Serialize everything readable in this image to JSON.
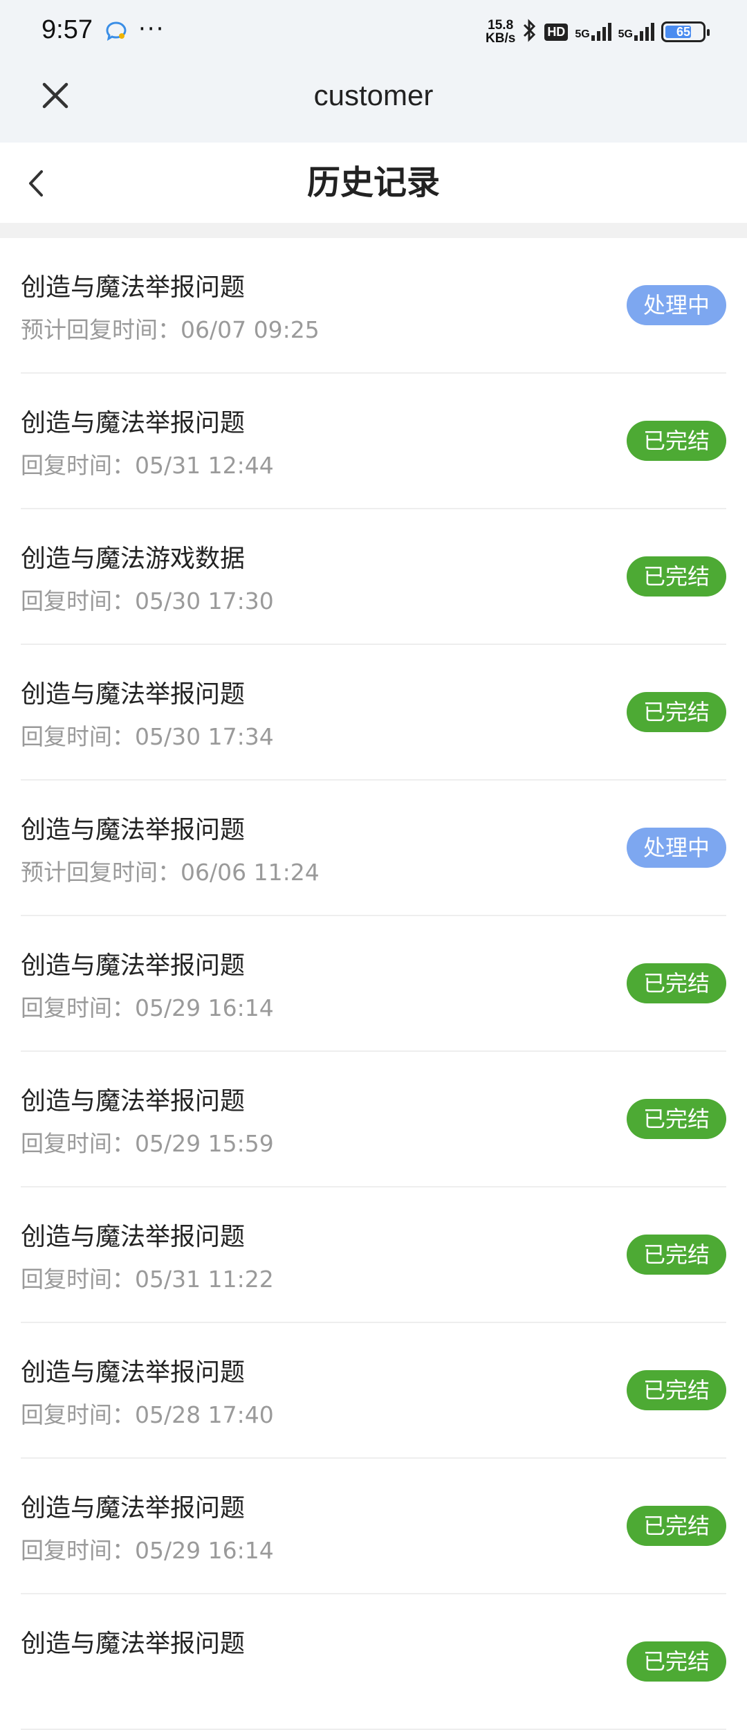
{
  "status_bar": {
    "time": "9:57",
    "more": "···",
    "net_speed_value": "15.8",
    "net_speed_unit": "KB/s",
    "hd": "HD",
    "sim1": "5G",
    "sim2": "5G",
    "battery": "65",
    "icons": [
      "message-icon",
      "bluetooth-icon",
      "signal-icon",
      "battery-icon"
    ]
  },
  "app_bar": {
    "title": "customer",
    "close_icon": "close-icon"
  },
  "nav": {
    "title": "历史记录",
    "back_icon": "chevron-left-icon"
  },
  "colors": {
    "processing": "#7da7f0",
    "done": "#4daa34",
    "subtext": "#9a9a9a"
  },
  "records": [
    {
      "title": "创造与魔法举报问题",
      "time": "预计回复时间：06/07 09:25",
      "status": "处理中",
      "state": "processing"
    },
    {
      "title": "创造与魔法举报问题",
      "time": "回复时间：05/31 12:44",
      "status": "已完结",
      "state": "done"
    },
    {
      "title": "创造与魔法游戏数据",
      "time": "回复时间：05/30 17:30",
      "status": "已完结",
      "state": "done"
    },
    {
      "title": "创造与魔法举报问题",
      "time": "回复时间：05/30 17:34",
      "status": "已完结",
      "state": "done"
    },
    {
      "title": "创造与魔法举报问题",
      "time": "预计回复时间：06/06 11:24",
      "status": "处理中",
      "state": "processing"
    },
    {
      "title": "创造与魔法举报问题",
      "time": "回复时间：05/29 16:14",
      "status": "已完结",
      "state": "done"
    },
    {
      "title": "创造与魔法举报问题",
      "time": "回复时间：05/29 15:59",
      "status": "已完结",
      "state": "done"
    },
    {
      "title": "创造与魔法举报问题",
      "time": "回复时间：05/31 11:22",
      "status": "已完结",
      "state": "done"
    },
    {
      "title": "创造与魔法举报问题",
      "time": "回复时间：05/28 17:40",
      "status": "已完结",
      "state": "done"
    },
    {
      "title": "创造与魔法举报问题",
      "time": "回复时间：05/29 16:14",
      "status": "已完结",
      "state": "done"
    },
    {
      "title": "创造与魔法举报问题",
      "time": "",
      "status": "已完结",
      "state": "done"
    }
  ]
}
